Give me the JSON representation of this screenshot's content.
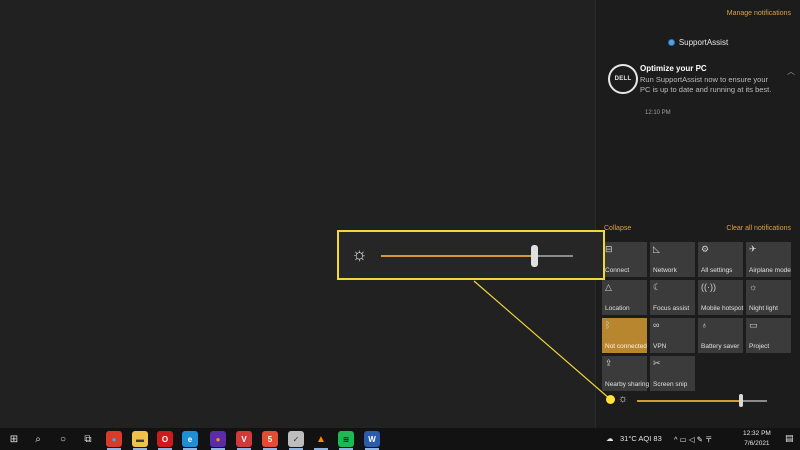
{
  "action_center": {
    "manage_notifications": "Manage notifications",
    "app_name": "SupportAssist",
    "notification": {
      "logo_text": "DELL",
      "title": "Optimize your PC",
      "body": "Run SupportAssist now to ensure your PC is up to date and running at its best.",
      "time": "12:10 PM"
    },
    "collapse": "Collapse",
    "clear_all": "Clear all notifications",
    "tiles": [
      {
        "label": "Connect",
        "icon": "connect-icon",
        "glyph": "⊟",
        "active": false
      },
      {
        "label": "Network",
        "icon": "network-icon",
        "glyph": "◺",
        "active": false
      },
      {
        "label": "All settings",
        "icon": "gear-icon",
        "glyph": "⚙",
        "active": false
      },
      {
        "label": "Airplane mode",
        "icon": "airplane-icon",
        "glyph": "✈",
        "active": false
      },
      {
        "label": "Location",
        "icon": "location-icon",
        "glyph": "△",
        "active": false
      },
      {
        "label": "Focus assist",
        "icon": "moon-icon",
        "glyph": "☾",
        "active": false
      },
      {
        "label": "Mobile hotspot",
        "icon": "hotspot-icon",
        "glyph": "((·))",
        "active": false
      },
      {
        "label": "Night light",
        "icon": "night-light-icon",
        "glyph": "☼",
        "active": false
      },
      {
        "label": "Not connected",
        "icon": "bluetooth-icon",
        "glyph": "ᛒ",
        "active": true
      },
      {
        "label": "VPN",
        "icon": "vpn-icon",
        "glyph": "∞",
        "active": false
      },
      {
        "label": "Battery saver",
        "icon": "battery-saver-icon",
        "glyph": "♁",
        "active": false
      },
      {
        "label": "Project",
        "icon": "project-icon",
        "glyph": "▭",
        "active": false
      },
      {
        "label": "Nearby sharing",
        "icon": "nearby-sharing-icon",
        "glyph": "⇪",
        "active": false
      },
      {
        "label": "Screen snip",
        "icon": "screen-snip-icon",
        "glyph": "✂",
        "active": false
      }
    ],
    "brightness": {
      "icon": "sun-icon",
      "level": 0.8
    }
  },
  "callout": {
    "brightness_level": 0.8,
    "highlight_color": "#f3d63a"
  },
  "taskbar": {
    "apps": [
      {
        "name": "start",
        "icon": "windows-icon",
        "glyph": "⊞",
        "color": "#e6e6e6",
        "bg": "transparent"
      },
      {
        "name": "search",
        "icon": "search-icon",
        "glyph": "⌕",
        "color": "#e6e6e6",
        "bg": "transparent"
      },
      {
        "name": "cortana",
        "icon": "cortana-icon",
        "glyph": "○",
        "color": "#e6e6e6",
        "bg": "transparent"
      },
      {
        "name": "task-view",
        "icon": "task-view-icon",
        "glyph": "⧉",
        "color": "#e6e6e6",
        "bg": "transparent"
      },
      {
        "name": "chrome",
        "icon": "chrome-icon",
        "glyph": "●",
        "color": "#4aa3df",
        "bg": "#d93b2b"
      },
      {
        "name": "file-explorer",
        "icon": "folder-icon",
        "glyph": "▬",
        "color": "#3b3b3b",
        "bg": "#f0c04a"
      },
      {
        "name": "opera",
        "icon": "opera-icon",
        "glyph": "O",
        "color": "#ffffff",
        "bg": "#cc1b1b"
      },
      {
        "name": "edge",
        "icon": "edge-icon",
        "glyph": "e",
        "color": "#ffffff",
        "bg": "#1e8fd6"
      },
      {
        "name": "firefox",
        "icon": "firefox-icon",
        "glyph": "●",
        "color": "#ff8a1e",
        "bg": "#5b2ca8"
      },
      {
        "name": "vivaldi",
        "icon": "vivaldi-icon",
        "glyph": "V",
        "color": "#ffffff",
        "bg": "#d23a3a"
      },
      {
        "name": "app-5",
        "icon": "app-5-icon",
        "glyph": "5",
        "color": "#ffffff",
        "bg": "#e24b35"
      },
      {
        "name": "app-check",
        "icon": "check-app-icon",
        "glyph": "✓",
        "color": "#333333",
        "bg": "#bdbdbd"
      },
      {
        "name": "vlc",
        "icon": "vlc-icon",
        "glyph": "▲",
        "color": "#ff8a00",
        "bg": "transparent"
      },
      {
        "name": "spotify",
        "icon": "spotify-icon",
        "glyph": "≋",
        "color": "#111111",
        "bg": "#1db954"
      },
      {
        "name": "word",
        "icon": "word-icon",
        "glyph": "W",
        "color": "#ffffff",
        "bg": "#2b5cab"
      }
    ],
    "weather": "31°C  AQI 83",
    "tray_glyphs": "^ ▭ ◁ ✎ 〒",
    "time": "12:32 PM",
    "date": "7/6/2021",
    "notification_icon": "notification-icon"
  }
}
